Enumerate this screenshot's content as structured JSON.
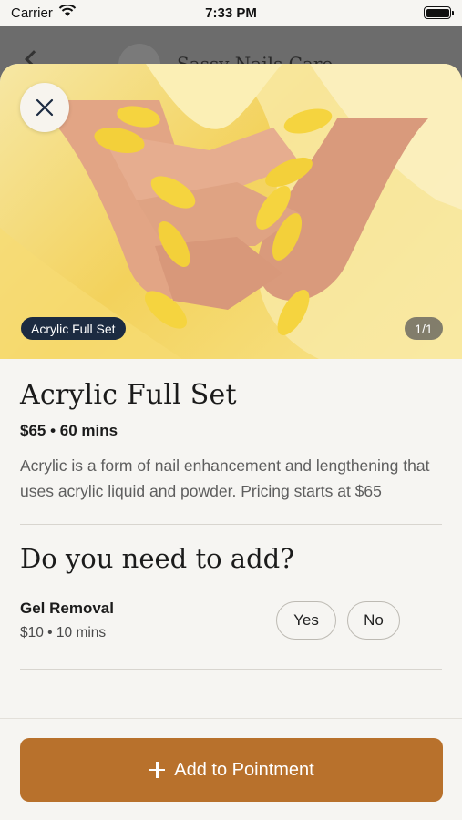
{
  "status_bar": {
    "carrier": "Carrier",
    "time": "7:33 PM"
  },
  "background": {
    "title": "Sassy Nails Care"
  },
  "hero": {
    "tag": "Acrylic Full Set",
    "counter": "1/1"
  },
  "service": {
    "name": "Acrylic Full Set",
    "meta": "$65 • 60 mins",
    "description": "Acrylic is a form of nail enhancement and lengthening that uses acrylic liquid and powder. Pricing starts at $65"
  },
  "addons": {
    "title": "Do you need to add?",
    "items": [
      {
        "name": "Gel Removal",
        "meta": "$10 • 10 mins",
        "yes_label": "Yes",
        "no_label": "No"
      }
    ]
  },
  "footer": {
    "cta_label": "Add to Pointment"
  },
  "colors": {
    "accent": "#b8712c",
    "tag_bg": "#1c2b41",
    "sheet_bg": "#f6f5f2"
  }
}
